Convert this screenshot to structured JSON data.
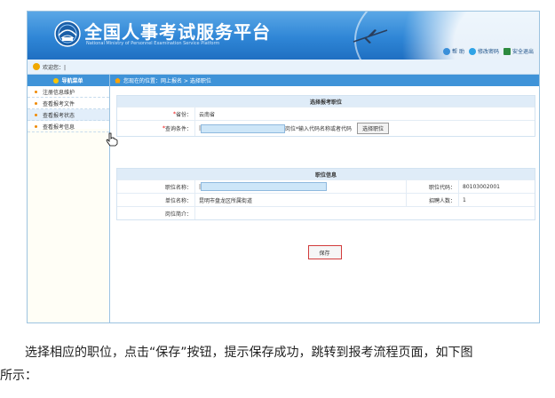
{
  "header": {
    "title": "全国人事考试服务平台",
    "subtitle": "National Ministry of Personnel Examination Service Platform",
    "links": [
      {
        "label": "帮 助",
        "icon": "help-icon",
        "color": "#3a8fd9"
      },
      {
        "label": "修改密码",
        "icon": "key-icon",
        "color": "#2fa3e6"
      },
      {
        "label": "安全退出",
        "icon": "exit-icon",
        "color": "#2d8a3e"
      }
    ]
  },
  "welcome": {
    "text": "欢迎您：|"
  },
  "sidebar": {
    "title": "导航菜单",
    "items": [
      {
        "label": "注册信息维护"
      },
      {
        "label": "查看报考文件"
      },
      {
        "label": "查看报考状态"
      },
      {
        "label": "查看报考信息"
      }
    ]
  },
  "breadcrumb": {
    "text": "您现在的位置：网上报名 > 选择职位"
  },
  "select_panel": {
    "title": "选择报考职位",
    "province_label": "省份：",
    "province_value": "云南省",
    "query_label": "查询条件：",
    "query_prefix": "|",
    "query_suffix": "岗位",
    "hint": "*输入代码名称或者代码",
    "select_button": "选择职位",
    "required_mark": "*"
  },
  "info_panel": {
    "title": "职位信息",
    "position_name_label": "职位名称：",
    "position_name_prefix": "|",
    "position_code_label": "职位代码：",
    "position_code_value": "80103002001",
    "unit_name_label": "单位名称：",
    "unit_name_value": "昆明市盘龙区所属街道",
    "recruit_label": "招聘人数：",
    "recruit_value": "1",
    "intro_label": "岗位简介："
  },
  "save_button": "保存",
  "caption": {
    "line1": "选择相应的职位，点击“保存”按钮，提示保存成功，跳转到报考流程页面，如下图",
    "line2": "所示："
  },
  "colors": {
    "header_blue": "#2f86d6",
    "bar_blue": "#3f93d8",
    "save_border": "#d23b3b",
    "input_fill": "#cde6f8"
  }
}
